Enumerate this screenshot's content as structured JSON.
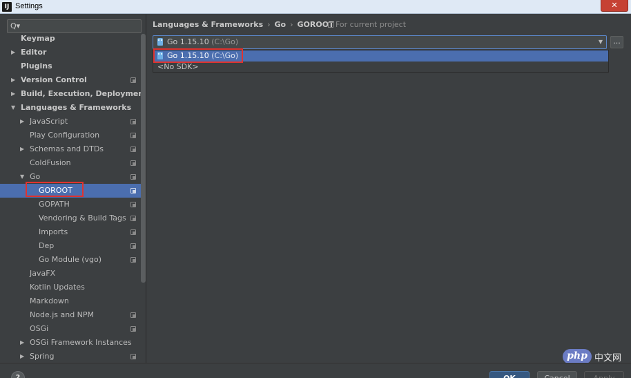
{
  "window": {
    "title": "Settings",
    "app_icon": "IJ",
    "close_label": "✕"
  },
  "search": {
    "value": "",
    "icon": "search-icon"
  },
  "sidebar": {
    "items": [
      {
        "label": "Keymap",
        "level": 0,
        "bold": true,
        "arrow": "",
        "project_icon": false
      },
      {
        "label": "Editor",
        "level": 0,
        "bold": true,
        "arrow": "▶",
        "project_icon": false
      },
      {
        "label": "Plugins",
        "level": 0,
        "bold": true,
        "arrow": "",
        "project_icon": false
      },
      {
        "label": "Version Control",
        "level": 0,
        "bold": true,
        "arrow": "▶",
        "project_icon": true
      },
      {
        "label": "Build, Execution, Deployment",
        "level": 0,
        "bold": true,
        "arrow": "▶",
        "project_icon": false
      },
      {
        "label": "Languages & Frameworks",
        "level": 0,
        "bold": true,
        "arrow": "▼",
        "project_icon": false
      },
      {
        "label": "JavaScript",
        "level": 1,
        "bold": false,
        "arrow": "▶",
        "project_icon": true
      },
      {
        "label": "Play Configuration",
        "level": 1,
        "bold": false,
        "arrow": "",
        "project_icon": true
      },
      {
        "label": "Schemas and DTDs",
        "level": 1,
        "bold": false,
        "arrow": "▶",
        "project_icon": true
      },
      {
        "label": "ColdFusion",
        "level": 1,
        "bold": false,
        "arrow": "",
        "project_icon": true
      },
      {
        "label": "Go",
        "level": 1,
        "bold": false,
        "arrow": "▼",
        "project_icon": true
      },
      {
        "label": "GOROOT",
        "level": 2,
        "bold": false,
        "arrow": "",
        "project_icon": true,
        "selected": true
      },
      {
        "label": "GOPATH",
        "level": 2,
        "bold": false,
        "arrow": "",
        "project_icon": true
      },
      {
        "label": "Vendoring & Build Tags",
        "level": 2,
        "bold": false,
        "arrow": "",
        "project_icon": true
      },
      {
        "label": "Imports",
        "level": 2,
        "bold": false,
        "arrow": "",
        "project_icon": true
      },
      {
        "label": "Dep",
        "level": 2,
        "bold": false,
        "arrow": "",
        "project_icon": true
      },
      {
        "label": "Go Module (vgo)",
        "level": 2,
        "bold": false,
        "arrow": "",
        "project_icon": true
      },
      {
        "label": "JavaFX",
        "level": 1,
        "bold": false,
        "arrow": "",
        "project_icon": false
      },
      {
        "label": "Kotlin Updates",
        "level": 1,
        "bold": false,
        "arrow": "",
        "project_icon": false
      },
      {
        "label": "Markdown",
        "level": 1,
        "bold": false,
        "arrow": "",
        "project_icon": false
      },
      {
        "label": "Node.js and NPM",
        "level": 1,
        "bold": false,
        "arrow": "",
        "project_icon": true
      },
      {
        "label": "OSGi",
        "level": 1,
        "bold": false,
        "arrow": "",
        "project_icon": true
      },
      {
        "label": "OSGi Framework Instances",
        "level": 1,
        "bold": false,
        "arrow": "▶",
        "project_icon": false
      },
      {
        "label": "Spring",
        "level": 1,
        "bold": false,
        "arrow": "▶",
        "project_icon": true
      }
    ]
  },
  "breadcrumb": {
    "part1": "Languages & Frameworks",
    "part2": "Go",
    "part3": "GOROOT",
    "separator": "›",
    "for_project": "For current project"
  },
  "sdk": {
    "selected_name": "Go 1.15.10",
    "selected_path": "(C:\\Go)",
    "more_label": "...",
    "options": [
      {
        "name": "Go 1.15.10",
        "path": "(C:\\Go)"
      },
      {
        "name": "<No SDK>",
        "path": ""
      }
    ]
  },
  "footer": {
    "help_label": "?",
    "ok_label": "OK",
    "cancel_label": "Cancel",
    "apply_label": "Apply"
  },
  "watermark": {
    "logo_text": "php",
    "cn_text": "中文网"
  },
  "colors": {
    "background": "#3c3f41",
    "selection": "#4b6eaf",
    "highlight_box": "#e0332f"
  }
}
